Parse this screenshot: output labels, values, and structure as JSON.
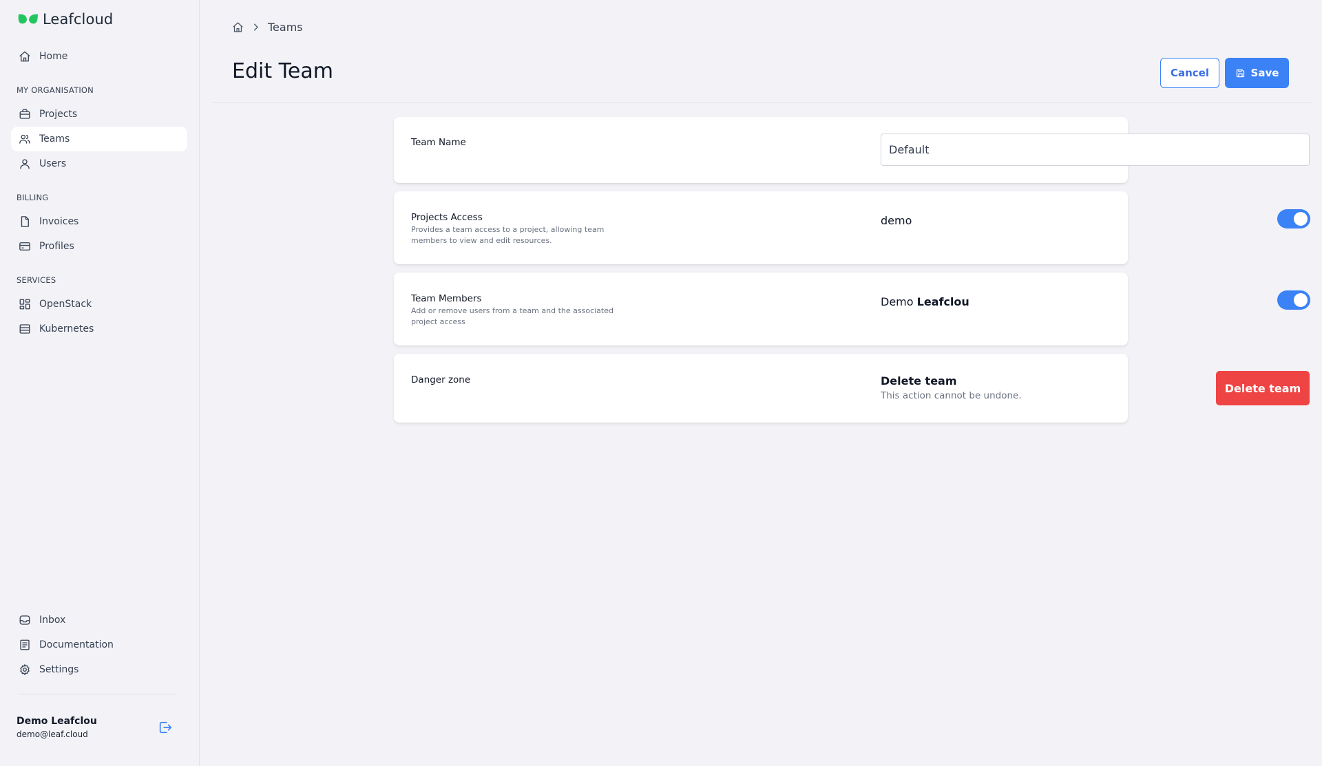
{
  "app": {
    "logo_text": "Leafcloud",
    "brand_color": "#22c55e",
    "accent_color": "#3b82f6",
    "danger_color": "#ef4444"
  },
  "sidebar": {
    "home": {
      "label": "Home",
      "icon": "home-icon"
    },
    "sections": {
      "organisation": "MY ORGANISATION",
      "billing": "BILLING",
      "services": "SERVICES"
    },
    "items": [
      {
        "label": "Projects",
        "icon": "briefcase-icon"
      },
      {
        "label": "Teams",
        "icon": "users-icon",
        "active": true
      },
      {
        "label": "Users",
        "icon": "user-icon"
      },
      {
        "label": "Invoices",
        "icon": "file-icon"
      },
      {
        "label": "Profiles",
        "icon": "credit-card-icon"
      },
      {
        "label": "OpenStack",
        "icon": "grid-icon"
      },
      {
        "label": "Kubernetes",
        "icon": "server-icon"
      }
    ],
    "bottom": [
      {
        "label": "Inbox",
        "icon": "inbox-icon"
      },
      {
        "label": "Documentation",
        "icon": "document-icon"
      },
      {
        "label": "Settings",
        "icon": "gear-icon"
      }
    ],
    "user": {
      "name": "Demo Leafclou",
      "email": "demo@leaf.cloud"
    }
  },
  "header": {
    "breadcrumb": [
      "Teams"
    ],
    "title": "Edit Team",
    "cancel_label": "Cancel",
    "save_label": "Save"
  },
  "form": {
    "team_name": {
      "label": "Team Name",
      "value": "Default"
    },
    "projects_access": {
      "label": "Projects Access",
      "description": "Provides a team access to a project, allowing team members to view and edit resources.",
      "project": "demo",
      "enabled": true
    },
    "team_members": {
      "label": "Team Members",
      "description": "Add or remove users from a team and the associated project access",
      "member_first": "Demo",
      "member_last": "Leafclou",
      "enabled": true
    },
    "danger_zone": {
      "label": "Danger zone",
      "title": "Delete team",
      "subtitle": "This action cannot be undone.",
      "button_label": "Delete team"
    }
  }
}
